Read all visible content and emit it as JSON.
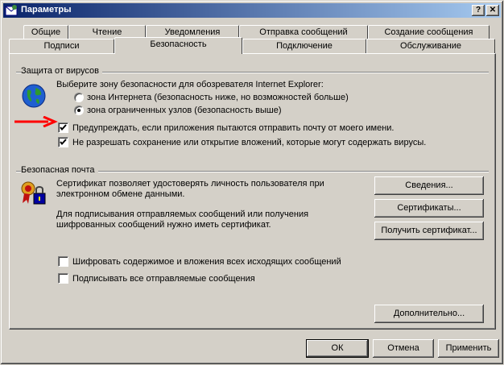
{
  "window": {
    "title": "Параметры",
    "help_label": "?",
    "close_label": "✕"
  },
  "tabs_row1": [
    "Общие",
    "Чтение",
    "Уведомления",
    "Отправка сообщений",
    "Создание сообщения"
  ],
  "tabs_row2": [
    "Подписи",
    "Безопасность",
    "Подключение",
    "Обслуживание"
  ],
  "virus": {
    "group_title": "Защита от вирусов",
    "zone_prompt": "Выберите зону безопасности для обозревателя Internet Explorer:",
    "radio_internet": "зона Интернета (безопасность ниже, но возможностей больше)",
    "radio_restricted": "зона ограниченных узлов (безопасность выше)",
    "radio_selected": "restricted",
    "check_warn": "Предупреждать, если приложения пытаются отправить почту от моего имени.",
    "check_warn_checked": true,
    "check_block": "Не разрешать сохранение или открытие вложений, которые могут содержать вирусы.",
    "check_block_checked": true,
    "arrow_color": "#ff0000"
  },
  "secure_mail": {
    "group_title": "Безопасная почта",
    "text1_line1": "Сертификат позволяет удостоверять личность пользователя при",
    "text1_line2": "электронном обмене данными.",
    "text2_line1": "Для подписывания отправляемых сообщений или получения",
    "text2_line2": "шифрованных сообщений нужно иметь сертификат.",
    "btn_details": "Сведения...",
    "btn_certs": "Сертификаты...",
    "btn_get_cert": "Получить сертификат...",
    "check_encrypt": "Шифровать содержимое и вложения всех исходящих сообщений",
    "check_encrypt_checked": false,
    "check_sign": "Подписывать все отправляемые сообщения",
    "check_sign_checked": false,
    "btn_advanced": "Дополнительно..."
  },
  "footer": {
    "ok": "ОК",
    "cancel": "Отмена",
    "apply": "Применить"
  },
  "colors": {
    "face": "#d4d0c8",
    "title_start": "#0a246a",
    "title_end": "#a6caf0"
  }
}
